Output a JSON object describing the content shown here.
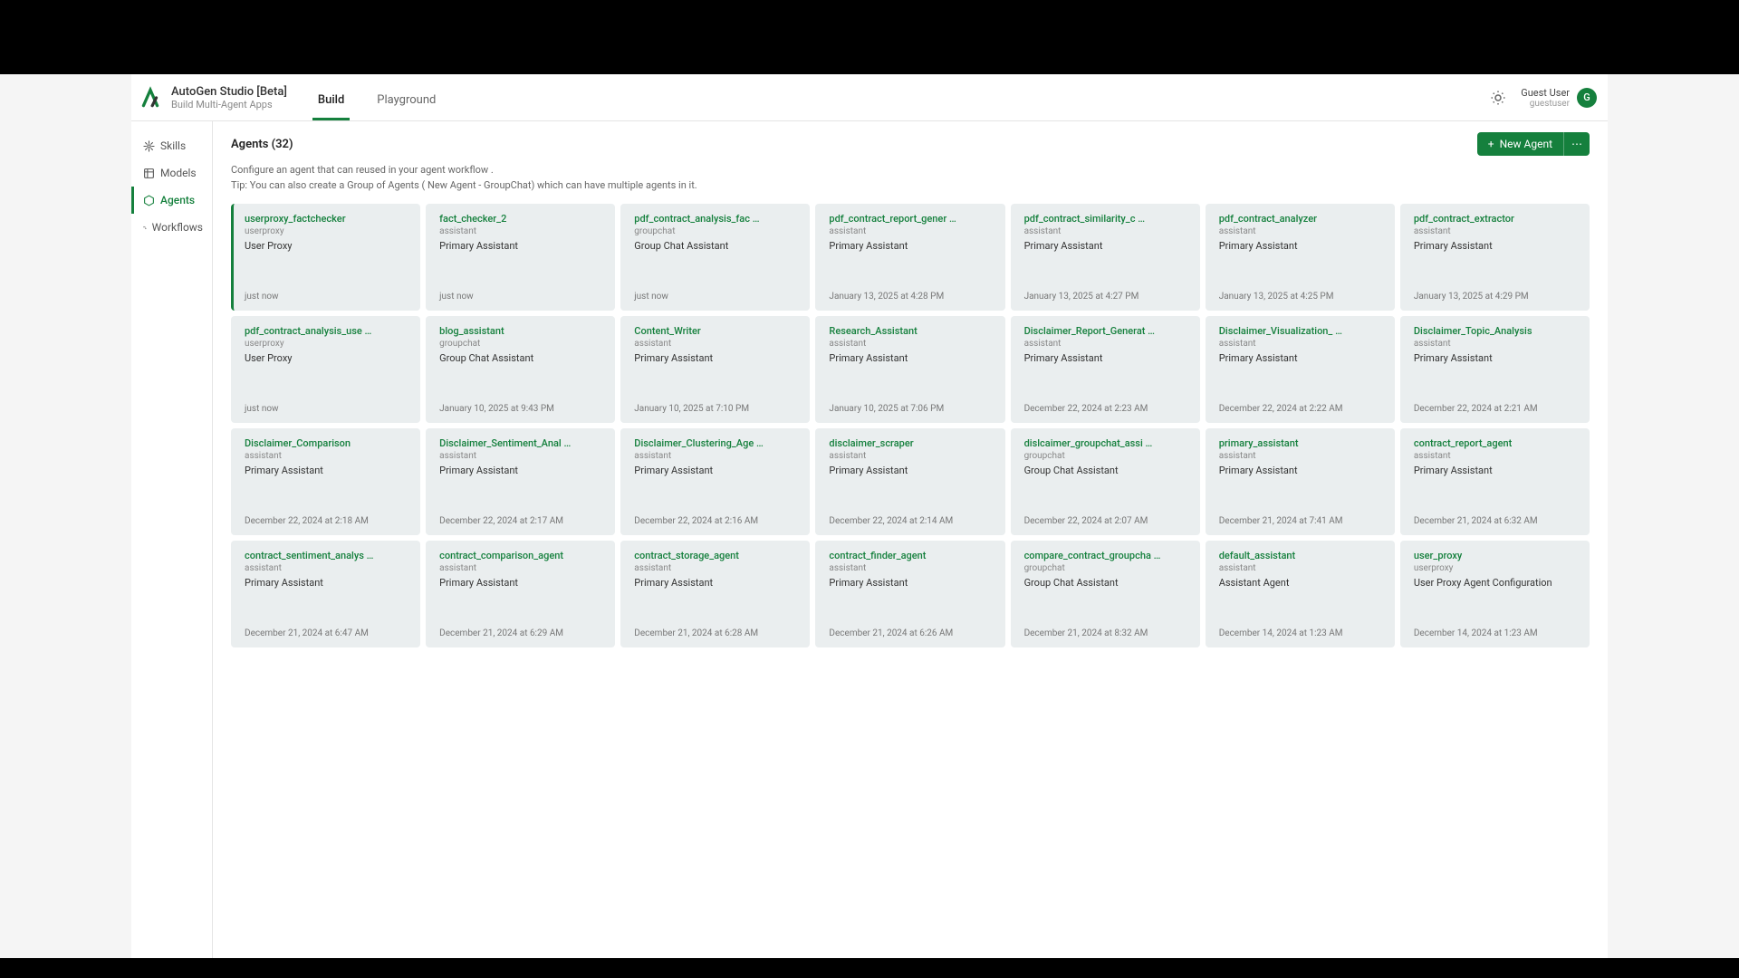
{
  "app": {
    "title": "AutoGen Studio [Beta]",
    "subtitle": "Build Multi-Agent Apps"
  },
  "nav": {
    "tabs": [
      {
        "label": "Build",
        "active": true
      },
      {
        "label": "Playground",
        "active": false
      }
    ]
  },
  "user": {
    "name": "Guest User",
    "login": "guestuser",
    "initial": "G"
  },
  "sidebar": {
    "items": [
      {
        "label": "Skills",
        "icon": "skills",
        "active": false
      },
      {
        "label": "Models",
        "icon": "models",
        "active": false
      },
      {
        "label": "Agents",
        "icon": "agents",
        "active": true
      },
      {
        "label": "Workflows",
        "icon": "workflows",
        "active": false
      }
    ]
  },
  "page": {
    "title": "Agents (32)",
    "description_line1": "Configure an agent that can reused in your agent workflow .",
    "description_line2": "Tip: You can also create a Group of Agents ( New Agent - GroupChat) which can have multiple agents in it.",
    "new_button": "New Agent",
    "more_button": "⋯"
  },
  "agents": [
    {
      "title": "userproxy_factchecker",
      "type": "userproxy",
      "desc": "User Proxy",
      "date": "just now"
    },
    {
      "title": "fact_checker_2",
      "type": "assistant",
      "desc": "Primary Assistant",
      "date": "just now"
    },
    {
      "title": "pdf_contract_analysis_fac …",
      "type": "groupchat",
      "desc": "Group Chat Assistant",
      "date": "just now"
    },
    {
      "title": "pdf_contract_report_gener …",
      "type": "assistant",
      "desc": "Primary Assistant",
      "date": "January 13, 2025 at 4:28 PM"
    },
    {
      "title": "pdf_contract_similarity_c …",
      "type": "assistant",
      "desc": "Primary Assistant",
      "date": "January 13, 2025 at 4:27 PM"
    },
    {
      "title": "pdf_contract_analyzer",
      "type": "assistant",
      "desc": "Primary Assistant",
      "date": "January 13, 2025 at 4:25 PM"
    },
    {
      "title": "pdf_contract_extractor",
      "type": "assistant",
      "desc": "Primary Assistant",
      "date": "January 13, 2025 at 4:29 PM"
    },
    {
      "title": "pdf_contract_analysis_use …",
      "type": "userproxy",
      "desc": "User Proxy",
      "date": "just now"
    },
    {
      "title": "blog_assistant",
      "type": "groupchat",
      "desc": "Group Chat Assistant",
      "date": "January 10, 2025 at 9:43 PM"
    },
    {
      "title": "Content_Writer",
      "type": "assistant",
      "desc": "Primary Assistant",
      "date": "January 10, 2025 at 7:10 PM"
    },
    {
      "title": "Research_Assistant",
      "type": "assistant",
      "desc": "Primary Assistant",
      "date": "January 10, 2025 at 7:06 PM"
    },
    {
      "title": "Disclaimer_Report_Generat …",
      "type": "assistant",
      "desc": "Primary Assistant",
      "date": "December 22, 2024 at 2:23 AM"
    },
    {
      "title": "Disclaimer_Visualization_ …",
      "type": "assistant",
      "desc": "Primary Assistant",
      "date": "December 22, 2024 at 2:22 AM"
    },
    {
      "title": "Disclaimer_Topic_Analysis",
      "type": "assistant",
      "desc": "Primary Assistant",
      "date": "December 22, 2024 at 2:21 AM"
    },
    {
      "title": "Disclaimer_Comparison",
      "type": "assistant",
      "desc": "Primary Assistant",
      "date": "December 22, 2024 at 2:18 AM"
    },
    {
      "title": "Disclaimer_Sentiment_Anal …",
      "type": "assistant",
      "desc": "Primary Assistant",
      "date": "December 22, 2024 at 2:17 AM"
    },
    {
      "title": "Disclaimer_Clustering_Age …",
      "type": "assistant",
      "desc": "Primary Assistant",
      "date": "December 22, 2024 at 2:16 AM"
    },
    {
      "title": "disclaimer_scraper",
      "type": "assistant",
      "desc": "Primary Assistant",
      "date": "December 22, 2024 at 2:14 AM"
    },
    {
      "title": "dislcaimer_groupchat_assi …",
      "type": "groupchat",
      "desc": "Group Chat Assistant",
      "date": "December 22, 2024 at 2:07 AM"
    },
    {
      "title": "primary_assistant",
      "type": "assistant",
      "desc": "Primary Assistant",
      "date": "December 21, 2024 at 7:41 AM"
    },
    {
      "title": "contract_report_agent",
      "type": "assistant",
      "desc": "Primary Assistant",
      "date": "December 21, 2024 at 6:32 AM"
    },
    {
      "title": "contract_sentiment_analys …",
      "type": "assistant",
      "desc": "Primary Assistant",
      "date": "December 21, 2024 at 6:47 AM"
    },
    {
      "title": "contract_comparison_agent",
      "type": "assistant",
      "desc": "Primary Assistant",
      "date": "December 21, 2024 at 6:29 AM"
    },
    {
      "title": "contract_storage_agent",
      "type": "assistant",
      "desc": "Primary Assistant",
      "date": "December 21, 2024 at 6:28 AM"
    },
    {
      "title": "contract_finder_agent",
      "type": "assistant",
      "desc": "Primary Assistant",
      "date": "December 21, 2024 at 6:26 AM"
    },
    {
      "title": "compare_contract_groupcha …",
      "type": "groupchat",
      "desc": "Group Chat Assistant",
      "date": "December 21, 2024 at 8:32 AM"
    },
    {
      "title": "default_assistant",
      "type": "assistant",
      "desc": "Assistant Agent",
      "date": "December 14, 2024 at 1:23 AM"
    },
    {
      "title": "user_proxy",
      "type": "userproxy",
      "desc": "User Proxy Agent Configuration",
      "date": "December 14, 2024 at 1:23 AM"
    }
  ]
}
